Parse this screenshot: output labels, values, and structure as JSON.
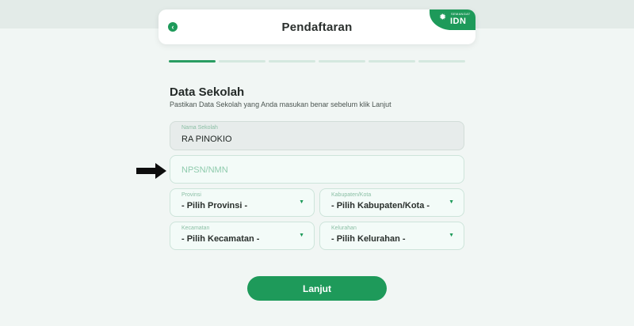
{
  "header": {
    "title": "Pendaftaran",
    "back_icon": "chevron-left-icon",
    "brand": {
      "small_text": "SEMANGAT",
      "logo_text": "IDN",
      "icon": "sun-icon"
    }
  },
  "steps": {
    "total": 6,
    "current": 1
  },
  "section": {
    "title": "Data Sekolah",
    "subtitle": "Pastikan Data Sekolah yang Anda masukan benar sebelum klik Lanjut"
  },
  "fields": {
    "school_name": {
      "label": "Nama Sekolah",
      "value": "RA PINOKIO"
    },
    "npsn": {
      "placeholder": "NPSN/NMN"
    },
    "province": {
      "label": "Provinsi",
      "value": "- Pilih Provinsi -"
    },
    "city": {
      "label": "Kabupaten/Kota",
      "value": "- Pilih Kabupaten/Kota -"
    },
    "district": {
      "label": "Kecamatan",
      "value": "- Pilih Kecamatan -"
    },
    "village": {
      "label": "Kelurahan",
      "value": "- Pilih Kelurahan -"
    }
  },
  "submit_label": "Lanjut",
  "colors": {
    "accent": "#1e9a5a",
    "background": "#f1f6f4",
    "field_bg": "#f3fbf8"
  }
}
